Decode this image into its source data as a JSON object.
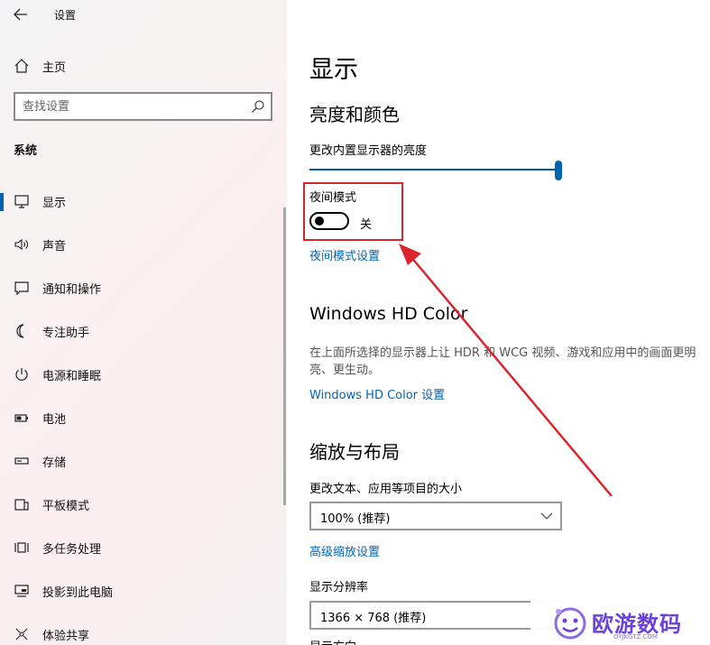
{
  "window": {
    "title": "设置"
  },
  "sidebar": {
    "home_label": "主页",
    "search_placeholder": "查找设置",
    "section_label": "系统",
    "items": [
      {
        "label": "显示",
        "icon": "monitor-icon"
      },
      {
        "label": "声音",
        "icon": "speaker-icon"
      },
      {
        "label": "通知和操作",
        "icon": "notification-icon"
      },
      {
        "label": "专注助手",
        "icon": "moon-icon"
      },
      {
        "label": "电源和睡眠",
        "icon": "power-icon"
      },
      {
        "label": "电池",
        "icon": "battery-icon"
      },
      {
        "label": "存储",
        "icon": "storage-icon"
      },
      {
        "label": "平板模式",
        "icon": "tablet-icon"
      },
      {
        "label": "多任务处理",
        "icon": "multitask-icon"
      },
      {
        "label": "投影到此电脑",
        "icon": "project-icon"
      },
      {
        "label": "体验共享",
        "icon": "share-icon"
      }
    ]
  },
  "main": {
    "title": "显示",
    "brightness_heading": "亮度和颜色",
    "brightness_label": "更改内置显示器的亮度",
    "brightness_value": 1.0,
    "night_light_label": "夜间模式",
    "night_light_state": "关",
    "night_light_link": "夜间模式设置",
    "hdr_heading": "Windows HD Color",
    "hdr_desc": "在上面所选择的显示器上让 HDR 和 WCG 视频、游戏和应用中的画面更明亮、更生动。",
    "hdr_link": "Windows HD Color 设置",
    "scale_heading": "缩放与布局",
    "scale_label": "更改文本、应用等项目的大小",
    "scale_value": "100% (推荐)",
    "advanced_scale_link": "高级缩放设置",
    "resolution_label": "显示分辨率",
    "resolution_value": "1366 × 768 (推荐)",
    "partial_label": "显示方向"
  },
  "watermark": {
    "brand": "欧游数码",
    "url": "OYJKGTZ.COM"
  },
  "colors": {
    "accent": "#0063b1",
    "highlight": "#d9262c"
  }
}
